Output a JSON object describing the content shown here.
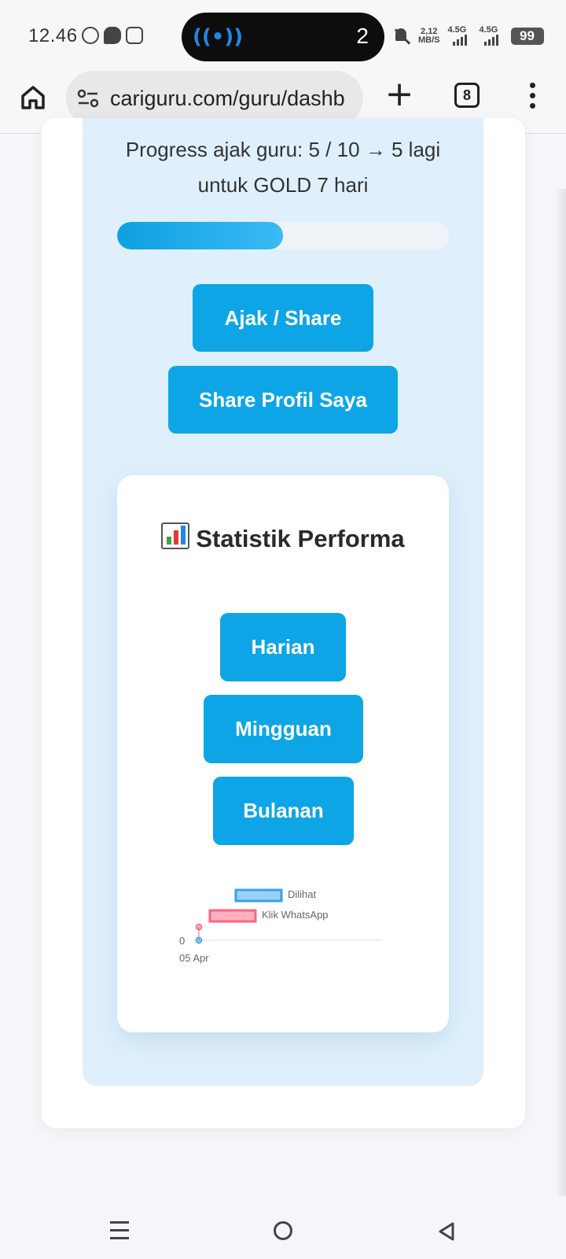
{
  "status_bar": {
    "time": "12.46",
    "app_icons": [
      "whatsapp-icon",
      "message-icon",
      "instagram-icon"
    ],
    "pill_count": "2",
    "net_speed_value": "2,12",
    "net_speed_unit": "MB/S",
    "signal1_label": "4.5G",
    "signal2_label": "4.5G",
    "battery": "99"
  },
  "browser": {
    "url": "cariguru.com/guru/dashb",
    "tab_count": "8"
  },
  "referral": {
    "progress_text": "Progress ajak guru: 5 / 10 → 5 lagi untuk GOLD 7 hari",
    "progress_current": 5,
    "progress_target": 10,
    "progress_fraction": 0.5,
    "ajak_label": "Ajak / Share",
    "share_profile_label": "Share Profil Saya"
  },
  "stats": {
    "title": "Statistik Performa",
    "harian_label": "Harian",
    "mingguan_label": "Mingguan",
    "bulanan_label": "Bulanan"
  },
  "chart_data": {
    "type": "line",
    "x": [
      "05 Apr"
    ],
    "series": [
      {
        "name": "Dilihat",
        "values": [
          0
        ],
        "color": "#36a2eb"
      },
      {
        "name": "Klik WhatsApp",
        "values": [
          0
        ],
        "color": "#ff6384"
      }
    ],
    "y_tick_labels": [
      "0"
    ],
    "legend": "top",
    "grid": true
  },
  "colors": {
    "accent": "#0ea5e6",
    "panel_bg": "#dff0fc"
  }
}
